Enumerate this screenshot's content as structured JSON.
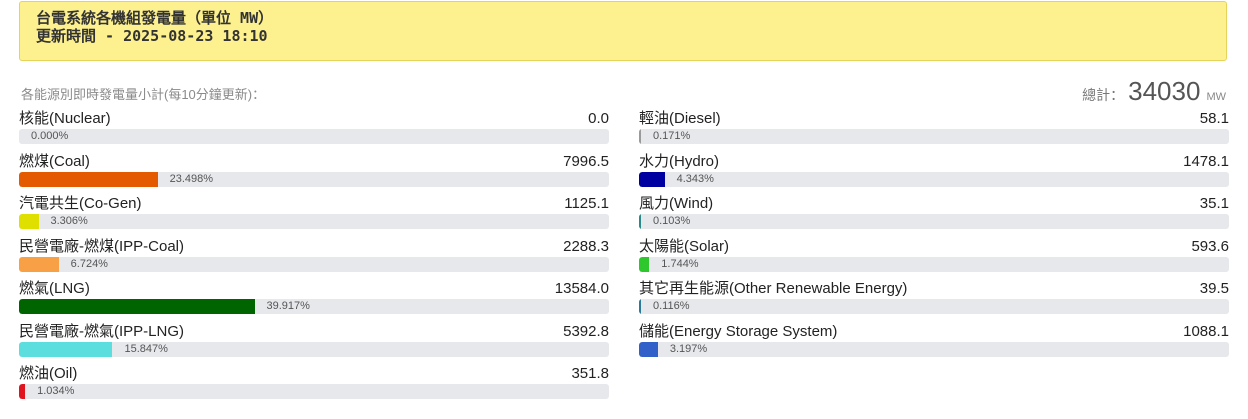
{
  "header": {
    "title": "台電系統各機組發電量（單位 MW）",
    "updated": "更新時間 - 2025-08-23 18:10"
  },
  "subhead": "各能源別即時發電量小計(每10分鐘更新)：",
  "total": {
    "label": "總計：",
    "value": "34030",
    "unit": "MW"
  },
  "sources_left": [
    {
      "name": "核能(Nuclear)",
      "value": "0.0",
      "percent": 0.0,
      "percent_label": "0.000%",
      "color": "#888888"
    },
    {
      "name": "燃煤(Coal)",
      "value": "7996.5",
      "percent": 23.498,
      "percent_label": "23.498%",
      "color": "#e35a00"
    },
    {
      "name": "汽電共生(Co-Gen)",
      "value": "1125.1",
      "percent": 3.306,
      "percent_label": "3.306%",
      "color": "#e0e000"
    },
    {
      "name": "民營電廠-燃煤(IPP-Coal)",
      "value": "2288.3",
      "percent": 6.724,
      "percent_label": "6.724%",
      "color": "#f7a046"
    },
    {
      "name": "燃氣(LNG)",
      "value": "13584.0",
      "percent": 39.917,
      "percent_label": "39.917%",
      "color": "#006400"
    },
    {
      "name": "民營電廠-燃氣(IPP-LNG)",
      "value": "5392.8",
      "percent": 15.847,
      "percent_label": "15.847%",
      "color": "#5cdede"
    },
    {
      "name": "燃油(Oil)",
      "value": "351.8",
      "percent": 1.034,
      "percent_label": "1.034%",
      "color": "#e0141e"
    }
  ],
  "sources_right": [
    {
      "name": "輕油(Diesel)",
      "value": "58.1",
      "percent": 0.171,
      "percent_label": "0.171%",
      "color": "#9a9a9a"
    },
    {
      "name": "水力(Hydro)",
      "value": "1478.1",
      "percent": 4.343,
      "percent_label": "4.343%",
      "color": "#0000a0"
    },
    {
      "name": "風力(Wind)",
      "value": "35.1",
      "percent": 0.103,
      "percent_label": "0.103%",
      "color": "#2a8a8a"
    },
    {
      "name": "太陽能(Solar)",
      "value": "593.6",
      "percent": 1.744,
      "percent_label": "1.744%",
      "color": "#2ec82e"
    },
    {
      "name": "其它再生能源(Other Renewable Energy)",
      "value": "39.5",
      "percent": 0.116,
      "percent_label": "0.116%",
      "color": "#2a7a9a"
    },
    {
      "name": "儲能(Energy Storage System)",
      "value": "1088.1",
      "percent": 3.197,
      "percent_label": "3.197%",
      "color": "#3060c8"
    }
  ]
}
